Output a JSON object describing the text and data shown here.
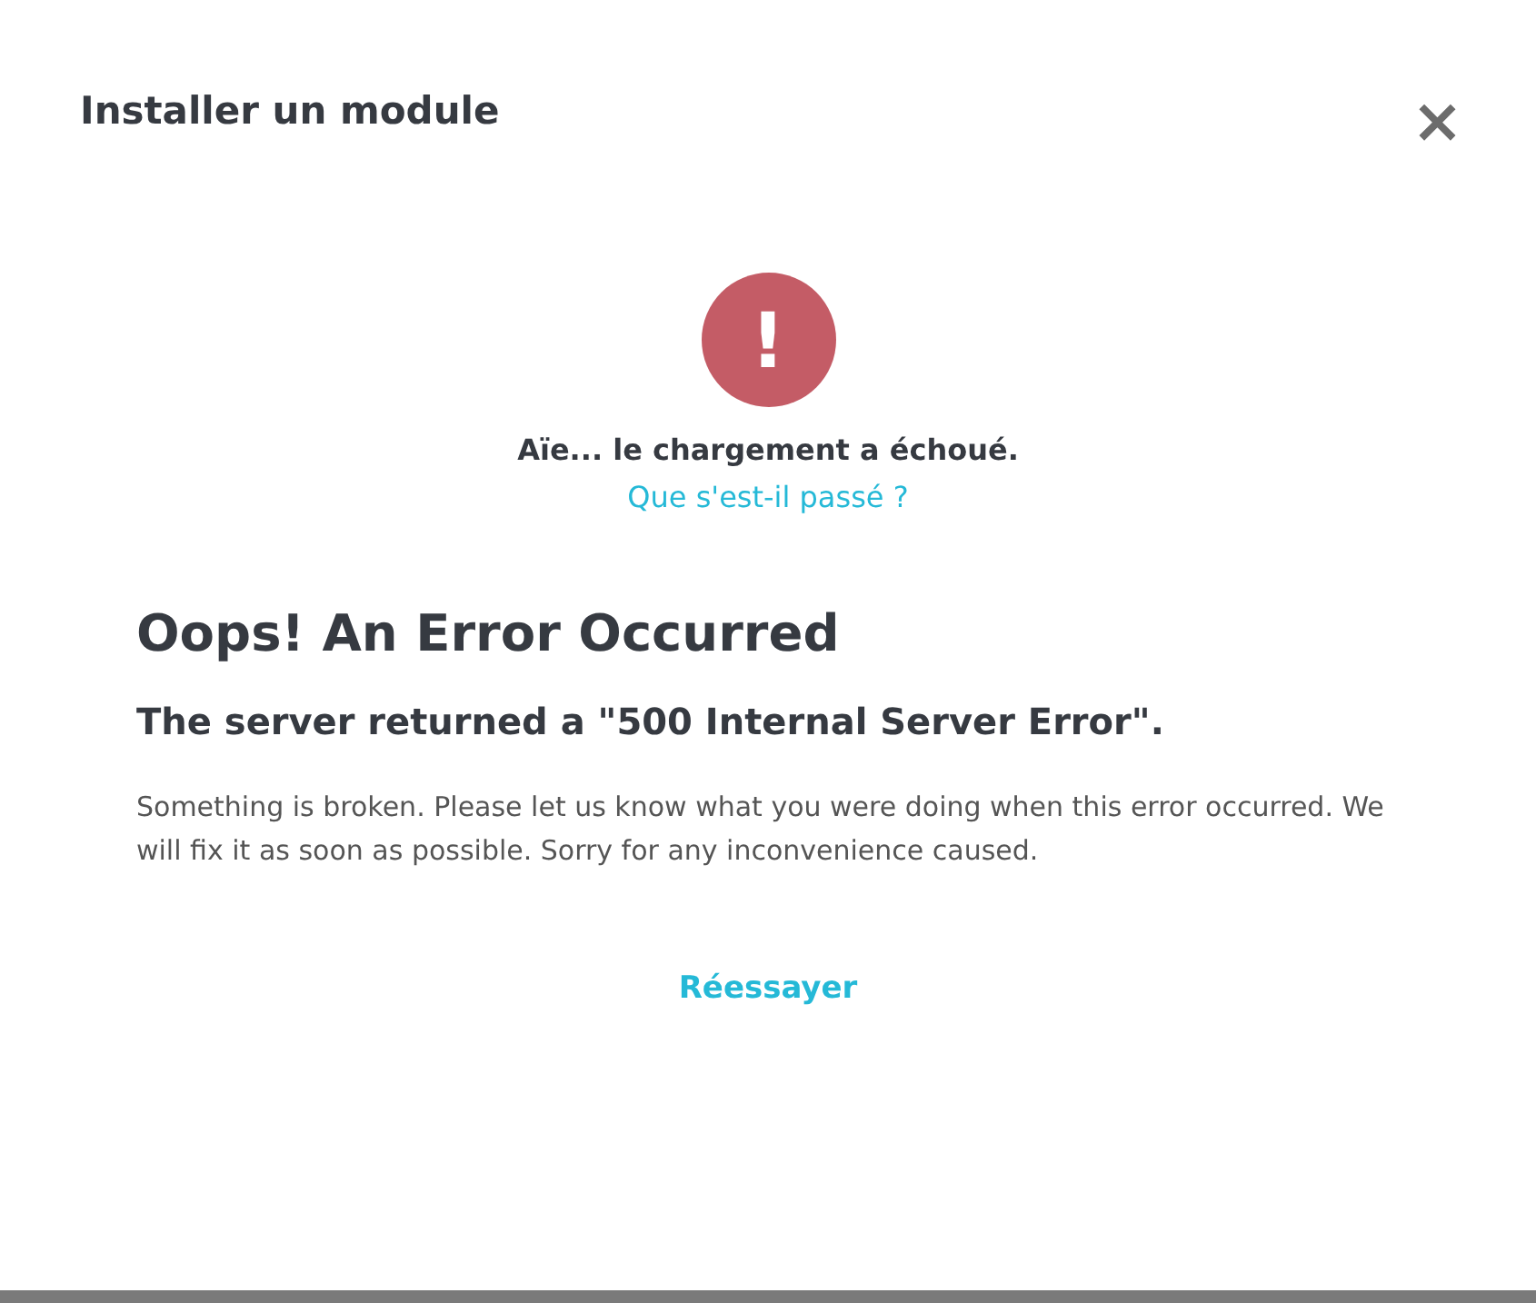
{
  "modal": {
    "title": "Installer un module",
    "close": "×"
  },
  "error_notice": {
    "icon": "!",
    "message": "Aïe... le chargement a échoué.",
    "link": "Que s'est-il passé ?"
  },
  "error_page": {
    "heading": "Oops! An Error Occurred",
    "subheading": "The server returned a \"500 Internal Server Error\".",
    "body": "Something is broken. Please let us know what you were doing when this error occurred. We will fix it as soon as possible. Sorry for any inconvenience caused."
  },
  "retry_button": "Réessayer"
}
